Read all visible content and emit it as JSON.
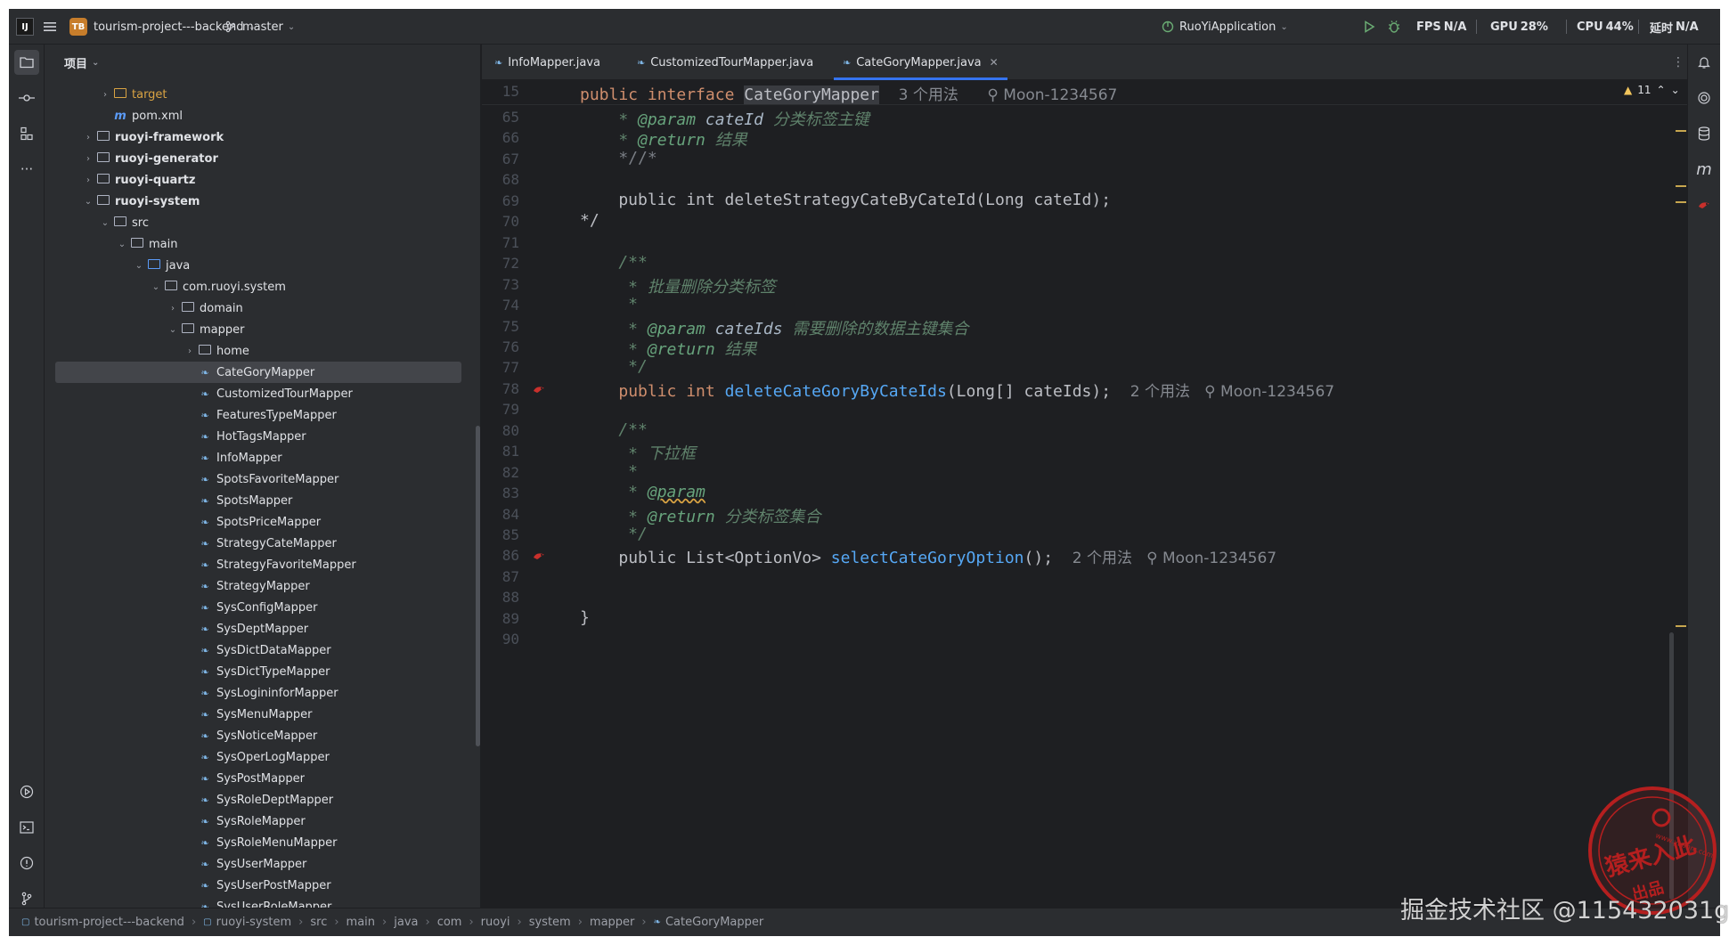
{
  "titlebar": {
    "project_badge": "TB",
    "project_name": "tourism-project---backend",
    "branch": "master",
    "run_config": "RuoYiApplication",
    "fps_label": "FPS",
    "fps_value": "N/A",
    "gpu_label": "GPU",
    "gpu_value": "28%",
    "cpu_label": "CPU",
    "cpu_value": "44%",
    "latency_label": "延时",
    "latency_value": "N/A"
  },
  "project_panel": {
    "title": "项目",
    "tree": [
      {
        "depth": 2,
        "expand": "collapsed",
        "icon": "folder-excl",
        "label": "target",
        "style": "orange"
      },
      {
        "depth": 2,
        "expand": "none",
        "icon": "maven",
        "label": "pom.xml",
        "style": "normal"
      },
      {
        "depth": 1,
        "expand": "collapsed",
        "icon": "folder",
        "label": "ruoyi-framework",
        "style": "bold"
      },
      {
        "depth": 1,
        "expand": "collapsed",
        "icon": "folder",
        "label": "ruoyi-generator",
        "style": "bold"
      },
      {
        "depth": 1,
        "expand": "collapsed",
        "icon": "folder",
        "label": "ruoyi-quartz",
        "style": "bold"
      },
      {
        "depth": 1,
        "expand": "expanded",
        "icon": "folder",
        "label": "ruoyi-system",
        "style": "bold"
      },
      {
        "depth": 2,
        "expand": "expanded",
        "icon": "folder",
        "label": "src",
        "style": "normal"
      },
      {
        "depth": 3,
        "expand": "expanded",
        "icon": "folder",
        "label": "main",
        "style": "normal"
      },
      {
        "depth": 4,
        "expand": "expanded",
        "icon": "folder-src",
        "label": "java",
        "style": "normal"
      },
      {
        "depth": 5,
        "expand": "expanded",
        "icon": "folder",
        "label": "com.ruoyi.system",
        "style": "normal"
      },
      {
        "depth": 6,
        "expand": "collapsed",
        "icon": "folder",
        "label": "domain",
        "style": "normal"
      },
      {
        "depth": 6,
        "expand": "expanded",
        "icon": "folder",
        "label": "mapper",
        "style": "normal"
      },
      {
        "depth": 7,
        "expand": "collapsed",
        "icon": "folder",
        "label": "home",
        "style": "normal"
      },
      {
        "depth": 7,
        "expand": "none",
        "icon": "mapper",
        "label": "CateGoryMapper",
        "style": "normal",
        "selected": true
      },
      {
        "depth": 7,
        "expand": "none",
        "icon": "mapper",
        "label": "CustomizedTourMapper",
        "style": "normal"
      },
      {
        "depth": 7,
        "expand": "none",
        "icon": "mapper",
        "label": "FeaturesTypeMapper",
        "style": "normal"
      },
      {
        "depth": 7,
        "expand": "none",
        "icon": "mapper",
        "label": "HotTagsMapper",
        "style": "normal"
      },
      {
        "depth": 7,
        "expand": "none",
        "icon": "mapper",
        "label": "InfoMapper",
        "style": "normal"
      },
      {
        "depth": 7,
        "expand": "none",
        "icon": "mapper",
        "label": "SpotsFavoriteMapper",
        "style": "normal"
      },
      {
        "depth": 7,
        "expand": "none",
        "icon": "mapper",
        "label": "SpotsMapper",
        "style": "normal"
      },
      {
        "depth": 7,
        "expand": "none",
        "icon": "mapper",
        "label": "SpotsPriceMapper",
        "style": "normal"
      },
      {
        "depth": 7,
        "expand": "none",
        "icon": "mapper",
        "label": "StrategyCateMapper",
        "style": "normal"
      },
      {
        "depth": 7,
        "expand": "none",
        "icon": "mapper",
        "label": "StrategyFavoriteMapper",
        "style": "normal"
      },
      {
        "depth": 7,
        "expand": "none",
        "icon": "mapper",
        "label": "StrategyMapper",
        "style": "normal"
      },
      {
        "depth": 7,
        "expand": "none",
        "icon": "mapper",
        "label": "SysConfigMapper",
        "style": "normal"
      },
      {
        "depth": 7,
        "expand": "none",
        "icon": "mapper",
        "label": "SysDeptMapper",
        "style": "normal"
      },
      {
        "depth": 7,
        "expand": "none",
        "icon": "mapper",
        "label": "SysDictDataMapper",
        "style": "normal"
      },
      {
        "depth": 7,
        "expand": "none",
        "icon": "mapper",
        "label": "SysDictTypeMapper",
        "style": "normal"
      },
      {
        "depth": 7,
        "expand": "none",
        "icon": "mapper",
        "label": "SysLogininforMapper",
        "style": "normal"
      },
      {
        "depth": 7,
        "expand": "none",
        "icon": "mapper",
        "label": "SysMenuMapper",
        "style": "normal"
      },
      {
        "depth": 7,
        "expand": "none",
        "icon": "mapper",
        "label": "SysNoticeMapper",
        "style": "normal"
      },
      {
        "depth": 7,
        "expand": "none",
        "icon": "mapper",
        "label": "SysOperLogMapper",
        "style": "normal"
      },
      {
        "depth": 7,
        "expand": "none",
        "icon": "mapper",
        "label": "SysPostMapper",
        "style": "normal"
      },
      {
        "depth": 7,
        "expand": "none",
        "icon": "mapper",
        "label": "SysRoleDeptMapper",
        "style": "normal"
      },
      {
        "depth": 7,
        "expand": "none",
        "icon": "mapper",
        "label": "SysRoleMapper",
        "style": "normal"
      },
      {
        "depth": 7,
        "expand": "none",
        "icon": "mapper",
        "label": "SysRoleMenuMapper",
        "style": "normal"
      },
      {
        "depth": 7,
        "expand": "none",
        "icon": "mapper",
        "label": "SysUserMapper",
        "style": "normal"
      },
      {
        "depth": 7,
        "expand": "none",
        "icon": "mapper",
        "label": "SysUserPostMapper",
        "style": "normal"
      },
      {
        "depth": 7,
        "expand": "none",
        "icon": "mapper",
        "label": "SysUserRoleMapper",
        "style": "normal"
      }
    ]
  },
  "tabs": [
    {
      "label": "InfoMapper.java",
      "active": false
    },
    {
      "label": "CustomizedTourMapper.java",
      "active": false
    },
    {
      "label": "CateGoryMapper.java",
      "active": true
    }
  ],
  "editor": {
    "warning_count": "11",
    "sticky": {
      "line": "15",
      "kw1": "public",
      "kw2": "interface",
      "name": "CateGoryMapper",
      "usages": "3 个用法",
      "author": "Moon-1234567"
    },
    "lines": [
      {
        "n": "65",
        "segs": [
          [
            "doc",
            "    * "
          ],
          [
            "doctag",
            "@param "
          ],
          [
            "docparam",
            "cateId "
          ],
          [
            "doctext",
            "分类标签主键"
          ]
        ]
      },
      {
        "n": "66",
        "segs": [
          [
            "doc",
            "    * "
          ],
          [
            "doctag",
            "@return "
          ],
          [
            "doctext",
            "结果"
          ]
        ]
      },
      {
        "n": "67",
        "segs": [
          [
            "cmt",
            "    *//*"
          ]
        ]
      },
      {
        "n": "68",
        "segs": []
      },
      {
        "n": "69",
        "segs": [
          [
            "plain",
            "    public int deleteStrategyCateByCateId(Long cateId);"
          ]
        ]
      },
      {
        "n": "70",
        "segs": [
          [
            "plain",
            "*/"
          ]
        ]
      },
      {
        "n": "71",
        "segs": []
      },
      {
        "n": "72",
        "segs": [
          [
            "doc",
            "    /**"
          ]
        ]
      },
      {
        "n": "73",
        "segs": [
          [
            "doc",
            "     * "
          ],
          [
            "doctext",
            "批量删除分类标签"
          ]
        ]
      },
      {
        "n": "74",
        "segs": [
          [
            "doc",
            "     *"
          ]
        ]
      },
      {
        "n": "75",
        "segs": [
          [
            "doc",
            "     * "
          ],
          [
            "doctag",
            "@param "
          ],
          [
            "docparam",
            "cateIds "
          ],
          [
            "doctext",
            "需要删除的数据主键集合"
          ]
        ]
      },
      {
        "n": "76",
        "segs": [
          [
            "doc",
            "     * "
          ],
          [
            "doctag",
            "@return "
          ],
          [
            "doctext",
            "结果"
          ]
        ]
      },
      {
        "n": "77",
        "segs": [
          [
            "doc",
            "     */"
          ]
        ]
      },
      {
        "n": "78",
        "icon": true,
        "segs": [
          [
            "plain",
            "    "
          ],
          [
            "kw",
            "public "
          ],
          [
            "kw",
            "int "
          ],
          [
            "fn",
            "deleteCateGoryByCateIds"
          ],
          [
            "plain",
            "(Long[] cateIds);  "
          ],
          [
            "hint",
            "2 个用法   ⚲ Moon-1234567"
          ]
        ]
      },
      {
        "n": "79",
        "segs": []
      },
      {
        "n": "80",
        "segs": [
          [
            "doc",
            "    /**"
          ]
        ]
      },
      {
        "n": "81",
        "segs": [
          [
            "doc",
            "     * "
          ],
          [
            "doctext",
            "下拉框"
          ]
        ]
      },
      {
        "n": "82",
        "segs": [
          [
            "doc",
            "     *"
          ]
        ]
      },
      {
        "n": "83",
        "segs": [
          [
            "doc",
            "     * "
          ],
          [
            "doctag-u",
            "@param"
          ]
        ]
      },
      {
        "n": "84",
        "segs": [
          [
            "doc",
            "     * "
          ],
          [
            "doctag",
            "@return "
          ],
          [
            "doctext",
            "分类标签集合"
          ]
        ]
      },
      {
        "n": "85",
        "segs": [
          [
            "doc",
            "     */"
          ]
        ]
      },
      {
        "n": "86",
        "icon": true,
        "segs": [
          [
            "plain",
            "    "
          ],
          [
            "plain",
            "public List<OptionVo> "
          ],
          [
            "fn",
            "selectCateGoryOption"
          ],
          [
            "plain",
            "();  "
          ],
          [
            "hint",
            "2 个用法   ⚲ Moon-1234567"
          ]
        ]
      },
      {
        "n": "87",
        "segs": []
      },
      {
        "n": "88",
        "segs": []
      },
      {
        "n": "89",
        "segs": [
          [
            "plain",
            "}"
          ]
        ]
      },
      {
        "n": "90",
        "segs": []
      }
    ]
  },
  "statusbar": {
    "breadcrumbs": [
      "tourism-project---backend",
      "ruoyi-system",
      "src",
      "main",
      "java",
      "com",
      "ruoyi",
      "system",
      "mapper",
      "CateGoryMapper"
    ]
  },
  "watermark": {
    "text": "掘金技术社区 @115432031g",
    "stamp_line1": "猿来入此",
    "stamp_line2": "出品",
    "stamp_url": "www.yuanrc.com"
  },
  "colors": {
    "bg": "#1e1f22",
    "panel": "#2b2d30",
    "accent": "#3574f0",
    "keyword": "#cf8e6d",
    "method": "#56a8f5",
    "doc": "#5f826b"
  }
}
